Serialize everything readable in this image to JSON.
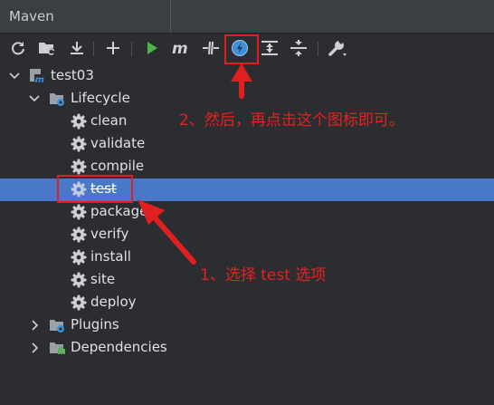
{
  "window": {
    "title": "Maven"
  },
  "toolbar": {
    "icons": [
      "reload-icon",
      "add-folder-reload-icon",
      "download-icon",
      "plus-icon",
      "run-icon",
      "maven-goal-icon",
      "toggle-offline-icon",
      "skip-tests-icon",
      "expand-all-icon",
      "collapse-all-icon",
      "wrench-icon"
    ]
  },
  "tree": {
    "project": {
      "label": "test03",
      "expanded": true
    },
    "lifecycle": {
      "label": "Lifecycle",
      "expanded": true,
      "items": [
        {
          "label": "clean"
        },
        {
          "label": "validate"
        },
        {
          "label": "compile"
        },
        {
          "label": "test",
          "selected": true
        },
        {
          "label": "package"
        },
        {
          "label": "verify"
        },
        {
          "label": "install"
        },
        {
          "label": "site"
        },
        {
          "label": "deploy"
        }
      ]
    },
    "plugins": {
      "label": "Plugins",
      "expanded": false
    },
    "dependencies": {
      "label": "Dependencies",
      "expanded": false
    }
  },
  "annotations": {
    "step1": "1、选择 test 选项",
    "step2": "2、然后，再点击这个图标即可。",
    "color": "#e02020"
  },
  "colors": {
    "background": "#2b2d30",
    "selection": "#4a78c9",
    "run_green": "#4fb34a",
    "skip_tests_blue": "#3d8fd6"
  }
}
